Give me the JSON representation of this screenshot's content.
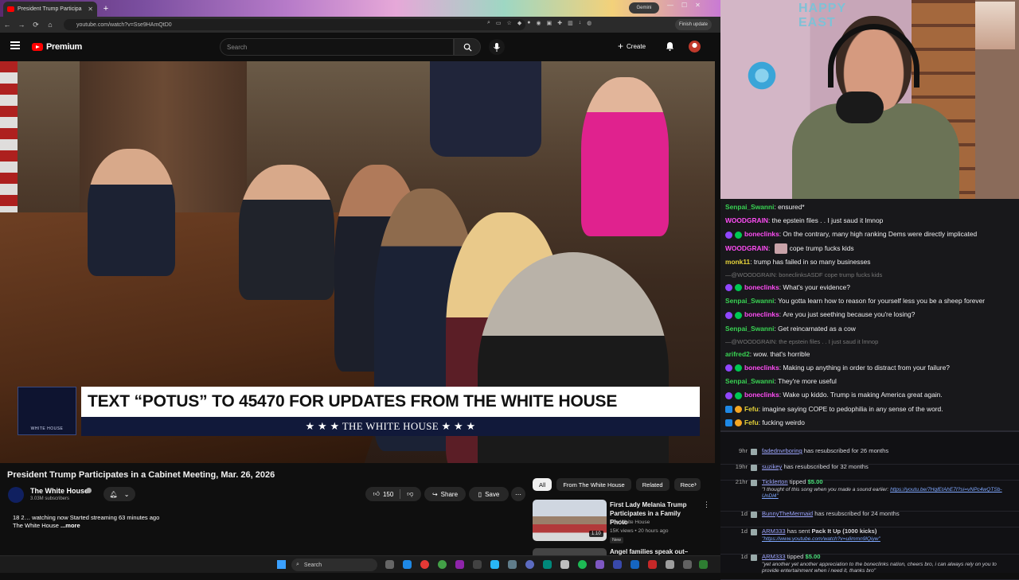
{
  "browser": {
    "tab_title": "President Trump Participa",
    "url": "youtube.com/watch?v=Sse9HAmQtD0",
    "gemini_label": "Gemini",
    "finish_update_label": "Finish update",
    "new_tab": "+"
  },
  "youtube": {
    "logo_text": "Premium",
    "search_placeholder": "Search",
    "create_label": "Create",
    "video": {
      "banner_text": "TEXT “POTUS” TO 45470 FOR UPDATES FROM THE WHITE HOUSE",
      "banner_sub": "★ ★ ★   THE WHITE HOUSE   ★ ★ ★",
      "logo_small": "WHITE HOUSE"
    },
    "title": "President Trump Participates in a Cabinet Meeting, Mar. 26, 2026",
    "channel": "The White House",
    "subscribers": "3.03M subscribers",
    "likes": "150",
    "share_label": "Share",
    "save_label": "Save",
    "description_line1": "18 2… watching now  Started streaming 63 minutes ago",
    "description_line2_channel": "The White House",
    "description_more": "...more",
    "chips": [
      "All",
      "From The White House",
      "Related",
      "Rece"
    ],
    "recommended": [
      {
        "title": "First Lady Melania Trump Participates in a Family Photo",
        "channel": "The White House",
        "meta": "15K views • 20 hours ago",
        "badge": "New",
        "duration": "1:10"
      },
      {
        "title": "Angel families speak out–"
      }
    ]
  },
  "taskbar": {
    "search_label": "Search"
  },
  "webcam": {
    "sign_text": "HAPPY EAST"
  },
  "chat": {
    "messages": [
      {
        "user": "Senpai_Swanni",
        "text": "ensured*",
        "color": "u-green",
        "badges": []
      },
      {
        "user": "WOODGRAIN",
        "text": "the epstein files . . I just saud it lmnop",
        "color": "u-pink",
        "badges": []
      },
      {
        "user": "boneclinks",
        "text": "On the contrary, many high ranking Dems were directly implicated",
        "color": "u-pink",
        "badges": [
          "b-purple",
          "b-green"
        ]
      },
      {
        "user": "WOODGRAIN",
        "text": "cope trump fucks kids",
        "color": "u-pink",
        "badges": [],
        "emote": true
      },
      {
        "user": "monk11",
        "text": "trump has failed in so many businesses",
        "color": "u-yellow",
        "badges": []
      },
      {
        "reply": "—@WOODGRAIN: boneclinksASDF cope trump fucks kids"
      },
      {
        "user": "boneclinks",
        "text": "What's your evidence?",
        "color": "u-pink",
        "badges": [
          "b-purple",
          "b-green"
        ]
      },
      {
        "user": "Senpai_Swanni",
        "text": "You gotta learn how to reason for yourself less you be a sheep forever",
        "color": "u-green",
        "badges": []
      },
      {
        "user": "boneclinks",
        "text": "Are you just seething because you're losing?",
        "color": "u-pink",
        "badges": [
          "b-purple",
          "b-green"
        ]
      },
      {
        "user": "Senpai_Swanni",
        "text": "Get reincarnated as a cow",
        "color": "u-green",
        "badges": []
      },
      {
        "reply": "—@WOODGRAIN: the epstein files . . I just saud it lmnop"
      },
      {
        "user": "arifred2",
        "text": "wow. that's horrible",
        "color": "u-green",
        "badges": []
      },
      {
        "user": "boneclinks",
        "text": "Making up anything in order to distract from your failure?",
        "color": "u-pink",
        "badges": [
          "b-purple",
          "b-green"
        ]
      },
      {
        "user": "Senpai_Swanni",
        "text": "They're more useful",
        "color": "u-green",
        "badges": []
      },
      {
        "user": "boneclinks",
        "text": "Wake up kiddo. Trump is making America great again.",
        "color": "u-pink",
        "badges": [
          "b-purple",
          "b-green"
        ]
      },
      {
        "user": "Fefu",
        "text": "imagine saying COPE to pedophilia in any sense of the word.",
        "color": "u-yellow",
        "badges": [
          "b-blue",
          "b-orange"
        ]
      },
      {
        "user": "Fefu",
        "text": "fucking weirdo",
        "color": "u-yellow",
        "badges": [
          "b-blue",
          "b-orange"
        ]
      }
    ]
  },
  "events": [
    {
      "age": "9hr",
      "user": "fadednvrboring",
      "action": "has resubscribed for 26 months"
    },
    {
      "age": "19hr",
      "user": "suzikey",
      "action": "has resubscribed for 32 months"
    },
    {
      "age": "21hr",
      "user": "Ticklerton",
      "action": "tipped",
      "amount": "$5.00",
      "note": "\"I thought of this song when you made a sound earlier:",
      "link": "https://youtu.be/7HqlEtAhE7I?si=vNPc4wQTSb-UnDl4\""
    },
    {
      "age": "1d",
      "user": "BunnyTheMermaid",
      "action": "has resubscribed for 24 months"
    },
    {
      "age": "1d",
      "user": "ARM333",
      "action": "has sent",
      "item": "Pack It Up (1000 kicks)",
      "link": "\"https://www.youtube.com/watch?v=ulimmn9lQiyw\""
    },
    {
      "age": "1d",
      "user": "ARM333",
      "action": "tipped",
      "amount": "$5.00",
      "note": "\"yet another yet another appreciation to the boneclinks nation, cheers bro, i can always rely on you to provide entertainment when i need it, thanks bro\""
    }
  ]
}
